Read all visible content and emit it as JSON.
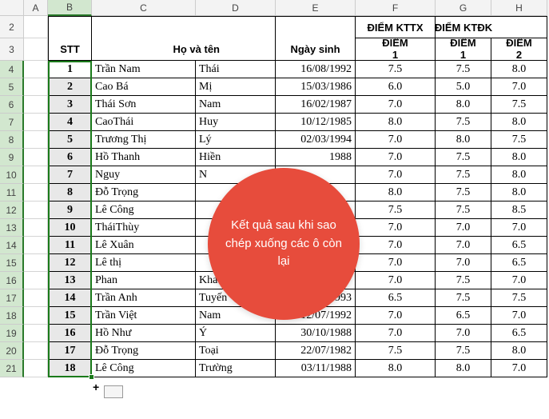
{
  "columns": [
    "A",
    "B",
    "C",
    "D",
    "E",
    "F",
    "G",
    "H"
  ],
  "rowNumbers": [
    2,
    3,
    4,
    5,
    6,
    7,
    8,
    9,
    10,
    11,
    12,
    13,
    14,
    15,
    16,
    17,
    18,
    19,
    20,
    21
  ],
  "header": {
    "stt": "STT",
    "hovaten": "Họ và tên",
    "ngaysinh": "Ngày sinh",
    "kttx": "ĐIỂM KTTX",
    "ktdk": "ĐIỂM KTĐK",
    "diem": "ĐIỂM",
    "n1": "1",
    "n2": "2"
  },
  "rows": [
    {
      "stt": "1",
      "ho": "Trần Nam",
      "ten": "Thái",
      "ns": "16/08/1992",
      "f": "7.5",
      "g": "7.5",
      "h": "8.0"
    },
    {
      "stt": "2",
      "ho": "Cao Bá",
      "ten": "Mị",
      "ns": "15/03/1986",
      "f": "6.0",
      "g": "5.0",
      "h": "7.0"
    },
    {
      "stt": "3",
      "ho": "Thái Sơn",
      "ten": "Nam",
      "ns": "16/02/1987",
      "f": "7.0",
      "g": "8.0",
      "h": "7.5"
    },
    {
      "stt": "4",
      "ho": "CaoThái",
      "ten": "Huy",
      "ns": "10/12/1985",
      "f": "8.0",
      "g": "7.5",
      "h": "8.0"
    },
    {
      "stt": "5",
      "ho": "Trương Thị",
      "ten": "Lý",
      "ns": "02/03/1994",
      "f": "7.0",
      "g": "8.0",
      "h": "7.5"
    },
    {
      "stt": "6",
      "ho": "Hồ Thanh",
      "ten": "Hiền",
      "ns": "1988",
      "f": "7.0",
      "g": "7.5",
      "h": "8.0"
    },
    {
      "stt": "7",
      "ho": "Nguy",
      "ten": "N",
      "ns": "",
      "f": "7.0",
      "g": "7.5",
      "h": "8.0"
    },
    {
      "stt": "8",
      "ho": "Đỗ Trọng",
      "ten": "",
      "ns": "",
      "f": "8.0",
      "g": "7.5",
      "h": "8.0"
    },
    {
      "stt": "9",
      "ho": "Lê Công",
      "ten": "",
      "ns": "",
      "f": "7.5",
      "g": "7.5",
      "h": "8.5"
    },
    {
      "stt": "10",
      "ho": "TháiThùy",
      "ten": "",
      "ns": "",
      "f": "7.0",
      "g": "7.0",
      "h": "7.0"
    },
    {
      "stt": "11",
      "ho": "Lê Xuân",
      "ten": "",
      "ns": "",
      "f": "7.0",
      "g": "7.0",
      "h": "6.5"
    },
    {
      "stt": "12",
      "ho": "Lê thị",
      "ten": "",
      "ns": "",
      "f": "7.0",
      "g": "7.0",
      "h": "6.5"
    },
    {
      "stt": "13",
      "ho": "Phan",
      "ten": "Kha",
      "ns": "",
      "f": "7.0",
      "g": "7.5",
      "h": "7.0"
    },
    {
      "stt": "14",
      "ho": "Trần Anh",
      "ten": "Tuyến",
      "ns": "1993",
      "f": "6.5",
      "g": "7.5",
      "h": "7.5"
    },
    {
      "stt": "15",
      "ho": "Trần Việt",
      "ten": "Nam",
      "ns": "12/07/1992",
      "f": "7.0",
      "g": "6.5",
      "h": "7.0"
    },
    {
      "stt": "16",
      "ho": "Hồ Như",
      "ten": "Ý",
      "ns": "30/10/1988",
      "f": "7.0",
      "g": "7.0",
      "h": "6.5"
    },
    {
      "stt": "17",
      "ho": "Đỗ Trọng",
      "ten": "Toại",
      "ns": "22/07/1982",
      "f": "7.5",
      "g": "7.5",
      "h": "8.0"
    },
    {
      "stt": "18",
      "ho": "Lê Công",
      "ten": "Trường",
      "ns": "03/11/1988",
      "f": "8.0",
      "g": "8.0",
      "h": "7.0"
    }
  ],
  "callout": {
    "text": "Kết quả sau khi sao chép xuống các ô còn lại"
  }
}
